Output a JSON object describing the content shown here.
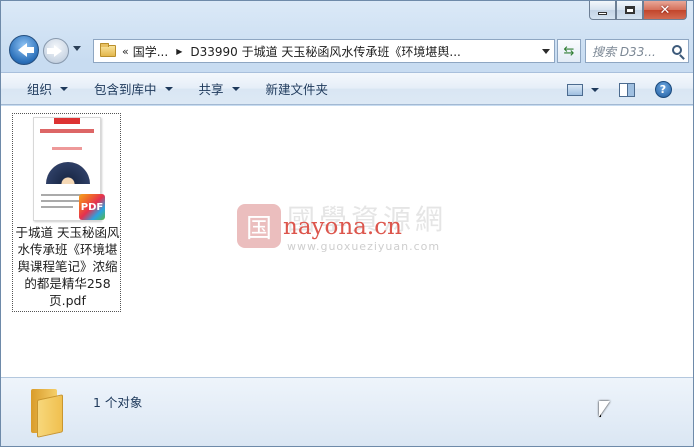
{
  "window": {
    "close_glyph": "✕"
  },
  "address": {
    "overflow_glyph": "«",
    "crumbs": [
      {
        "label": "国学..."
      },
      {
        "label": "D33990 于城道 天玉秘函风水传承班《环境堪舆..."
      }
    ],
    "separator_glyph": "▶"
  },
  "search": {
    "placeholder": "搜索 D33..."
  },
  "commands": {
    "organize": "组织",
    "include_in_library": "包含到库中",
    "share": "共享",
    "new_folder": "新建文件夹"
  },
  "help": {
    "glyph": "?"
  },
  "files": [
    {
      "name": "于城道 天玉秘函风水传承班《环境堪舆课程笔记》浓缩的都是精华258页.pdf",
      "type_badge": "PDF",
      "icon": "pdf-icon"
    }
  ],
  "watermark": {
    "seal_char": "国",
    "title": "國學資源網",
    "url": "nayona.cn",
    "sub_url": "www.guoxueziyuan.com"
  },
  "status": {
    "count_text": "1 个对象"
  }
}
